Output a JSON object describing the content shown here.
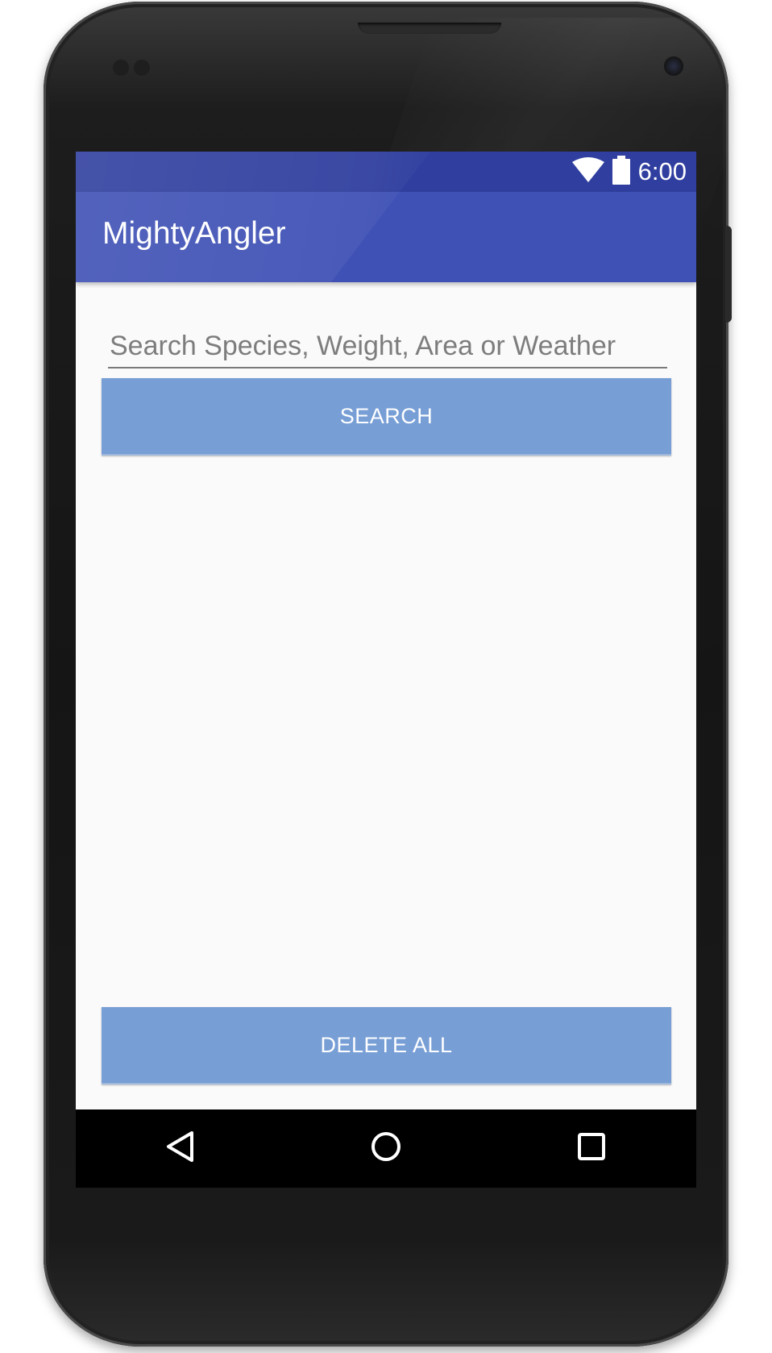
{
  "status_bar": {
    "time": "6:00",
    "wifi_icon": "wifi-icon",
    "battery_icon": "battery-icon"
  },
  "app_bar": {
    "title": "MightyAngler"
  },
  "main": {
    "search_placeholder": "Search Species, Weight, Area or Weather",
    "search_value": "",
    "search_button_label": "SEARCH",
    "delete_all_button_label": "DELETE ALL"
  },
  "nav_bar": {
    "back_icon": "back-triangle-icon",
    "home_icon": "home-circle-icon",
    "recents_icon": "recents-square-icon"
  },
  "colors": {
    "status_bar": "#303f9f",
    "app_bar": "#3f51b5",
    "button": "#779ed5",
    "background": "#fafafa"
  }
}
